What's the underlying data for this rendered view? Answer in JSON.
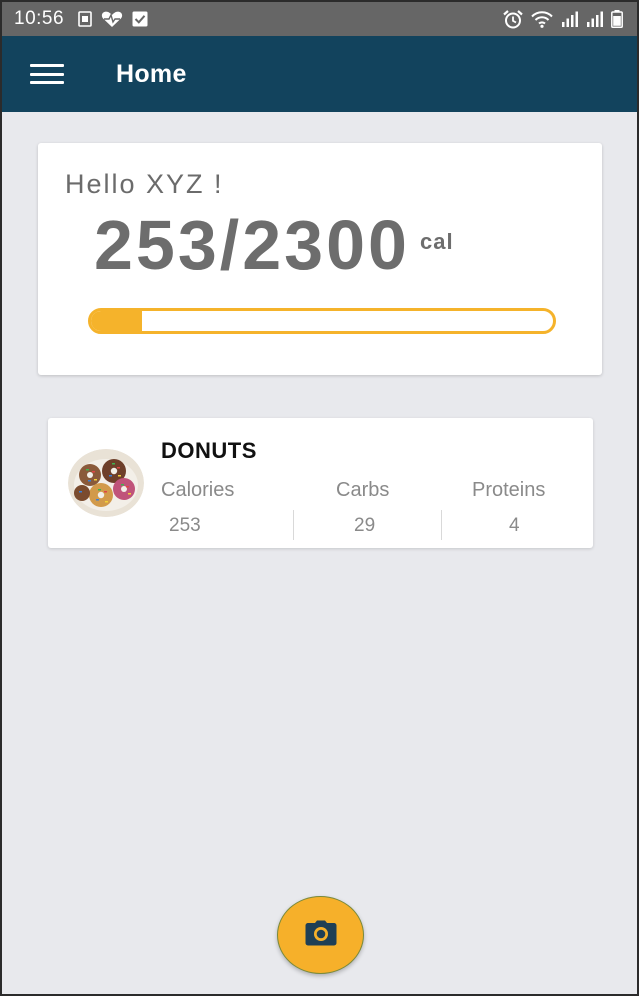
{
  "status_bar": {
    "time": "10:56",
    "icons_left": [
      "sim-card-icon",
      "heart-icon",
      "checkbox-icon"
    ],
    "icons_right": [
      "alarm-icon",
      "wifi-icon",
      "signal-icon",
      "signal-icon",
      "battery-icon"
    ]
  },
  "app_bar": {
    "title": "Home",
    "menu_icon": "hamburger-menu-icon"
  },
  "summary": {
    "greeting": "Hello XYZ !",
    "calories_consumed": 253,
    "calories_goal": 2300,
    "calories_display": "253/2300",
    "unit": "cal",
    "progress_fraction": 0.11
  },
  "food_item": {
    "name": "DONUTS",
    "calories_label": "Calories",
    "calories_value": "253",
    "carbs_label": "Carbs",
    "carbs_value": "29",
    "proteins_label": "Proteins",
    "proteins_value": "4"
  },
  "fab": {
    "icon": "camera-icon"
  },
  "colors": {
    "app_bar": "#12435d",
    "status_bar": "#666666",
    "accent": "#f5b32b",
    "background": "#e8e9ed"
  }
}
